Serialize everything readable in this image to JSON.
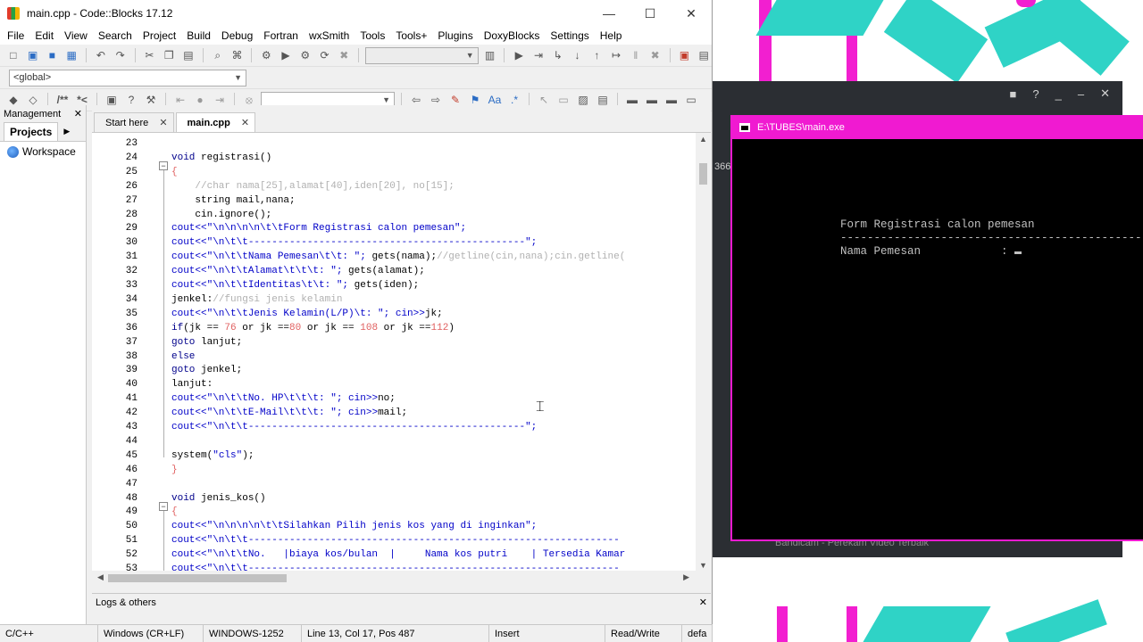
{
  "ide": {
    "window_title": "main.cpp - Code::Blocks 17.12",
    "menu": [
      "File",
      "Edit",
      "View",
      "Search",
      "Project",
      "Build",
      "Debug",
      "Fortran",
      "wxSmith",
      "Tools",
      "Tools+",
      "Plugins",
      "DoxyBlocks",
      "Settings",
      "Help"
    ],
    "scope_combo": "<global>",
    "management": {
      "title": "Management",
      "tab": "Projects",
      "workspace": "Workspace"
    },
    "tabs": [
      {
        "label": "Start here",
        "active": false
      },
      {
        "label": "main.cpp",
        "active": true
      }
    ],
    "code_lines": [
      {
        "n": "23",
        "html": ""
      },
      {
        "n": "24",
        "html": "<span class='kw'>void</span> registrasi()"
      },
      {
        "n": "25",
        "html": "<span class='num'>{</span>"
      },
      {
        "n": "26",
        "html": "    <span class='cmt'>//char nama[25],alamat[40],iden[20], no[15];</span>"
      },
      {
        "n": "27",
        "html": "    string mail,nana;"
      },
      {
        "n": "28",
        "html": "    cin.ignore();"
      },
      {
        "n": "29",
        "html": "<span class='str'>cout&lt;&lt;\"\\n\\n\\n\\n\\t\\tForm Registrasi calon pemesan\";</span>"
      },
      {
        "n": "30",
        "html": "<span class='str'>cout&lt;&lt;\"\\n\\t\\t-----------------------------------------------\";</span>"
      },
      {
        "n": "31",
        "html": "<span class='str'>cout&lt;&lt;\"\\n\\t\\tNama Pemesan\\t\\t: \";</span> gets(nama);<span class='cmt'>//getline(cin,nana);cin.getline(</span>"
      },
      {
        "n": "32",
        "html": "<span class='str'>cout&lt;&lt;\"\\n\\t\\tAlamat\\t\\t\\t: \";</span> gets(alamat);"
      },
      {
        "n": "33",
        "html": "<span class='str'>cout&lt;&lt;\"\\n\\t\\tIdentitas\\t\\t: \";</span> gets(iden);"
      },
      {
        "n": "34",
        "html": "jenkel:<span class='cmt'>//fungsi jenis kelamin</span>"
      },
      {
        "n": "35",
        "html": "<span class='str'>cout&lt;&lt;\"\\n\\t\\tJenis Kelamin(L/P)\\t: \";</span> <span class='str'>cin&gt;&gt;</span>jk;"
      },
      {
        "n": "36",
        "html": "<span class='kw'>if</span>(jk == <span class='num'>76</span> or jk ==<span class='num'>80</span> or jk == <span class='num'>108</span> or jk ==<span class='num'>112</span>)"
      },
      {
        "n": "37",
        "html": "<span class='kw'>goto</span> lanjut;"
      },
      {
        "n": "38",
        "html": "<span class='kw'>else</span>"
      },
      {
        "n": "39",
        "html": "<span class='kw'>goto</span> jenkel;"
      },
      {
        "n": "40",
        "html": "lanjut:"
      },
      {
        "n": "41",
        "html": "<span class='str'>cout&lt;&lt;\"\\n\\t\\tNo. HP\\t\\t\\t: \";</span> <span class='str'>cin&gt;&gt;</span>no;"
      },
      {
        "n": "42",
        "html": "<span class='str'>cout&lt;&lt;\"\\n\\t\\tE-Mail\\t\\t\\t: \";</span> <span class='str'>cin&gt;&gt;</span>mail;"
      },
      {
        "n": "43",
        "html": "<span class='str'>cout&lt;&lt;\"\\n\\t\\t-----------------------------------------------\";</span>"
      },
      {
        "n": "44",
        "html": ""
      },
      {
        "n": "45",
        "html": "system(<span class='str'>\"cls\"</span>);"
      },
      {
        "n": "46",
        "html": "<span class='num'>}</span>"
      },
      {
        "n": "47",
        "html": ""
      },
      {
        "n": "48",
        "html": "<span class='kw'>void</span> jenis_kos()"
      },
      {
        "n": "49",
        "html": "<span class='num'>{</span>"
      },
      {
        "n": "50",
        "html": "<span class='str'>cout&lt;&lt;\"\\n\\n\\n\\n\\t\\tSilahkan Pilih jenis kos yang di inginkan\";</span>"
      },
      {
        "n": "51",
        "html": "<span class='str'>cout&lt;&lt;\"\\n\\t\\t---------------------------------------------------------------</span>"
      },
      {
        "n": "52",
        "html": "<span class='str'>cout&lt;&lt;\"\\n\\t\\tNo.   |biaya kos/bulan  |     Nama kos putri    | Tersedia Kamar</span>"
      },
      {
        "n": "53",
        "html": "<span class='str'>cout&lt;&lt;\"\\n\\t\\t---------------------------------------------------------------</span>"
      }
    ],
    "logs_title": "Logs & others",
    "status": [
      "C/C++",
      "Windows (CR+LF)",
      "WINDOWS-1252",
      "Line 13, Col 17, Pos 487",
      "Insert",
      "Read/Write",
      "defa"
    ]
  },
  "console": {
    "title": "E:\\TUBES\\main.exe",
    "line1": "Form Registrasi calon pemesan",
    "line2": "----------------------------------------------------",
    "line3_label": "Nama Pemesan",
    "line3_colon": ":"
  },
  "background": {
    "side_text": "366",
    "footer_text": "Bandicam - Perekam Video Terbaik"
  }
}
